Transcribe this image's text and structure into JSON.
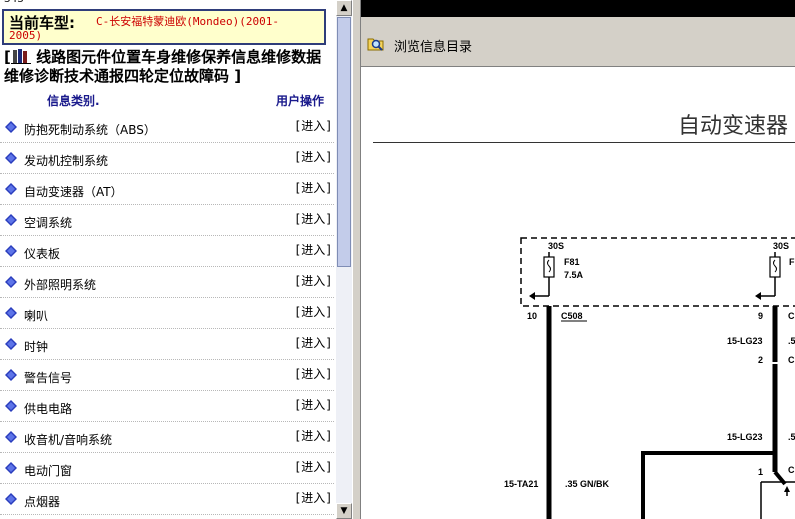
{
  "top_number": "343",
  "car": {
    "label": "当前车型:",
    "value_line1": "C-长安福特蒙迪欧(Mondeo)(2001-",
    "value_line2": "2005)"
  },
  "links_text": "线路图元件位置车身维修保养信息维修数据维修诊断技术通报四轮定位故障码",
  "header": {
    "category": "信息类别.",
    "action": "用户操作"
  },
  "rows": [
    {
      "name": "防抱死制动系统（ABS）",
      "action": "[进入]"
    },
    {
      "name": "发动机控制系统",
      "action": "[进入]"
    },
    {
      "name": "自动变速器（AT）",
      "action": "[进入]"
    },
    {
      "name": "空调系统",
      "action": "[进入]"
    },
    {
      "name": "仪表板",
      "action": "[进入]"
    },
    {
      "name": "外部照明系统",
      "action": "[进入]"
    },
    {
      "name": "喇叭",
      "action": "[进入]"
    },
    {
      "name": "时钟",
      "action": "[进入]"
    },
    {
      "name": "警告信号",
      "action": "[进入]"
    },
    {
      "name": "供电电路",
      "action": "[进入]"
    },
    {
      "name": "收音机/音响系统",
      "action": "[进入]"
    },
    {
      "name": "电动门窗",
      "action": "[进入]"
    },
    {
      "name": "点烟器",
      "action": "[进入]"
    }
  ],
  "right_toolbar": {
    "label": "浏览信息目录",
    "icon": "folder-search-icon"
  },
  "document": {
    "title": "自动变速器",
    "diagram_labels": {
      "a30s": "30S",
      "b30s": "30S",
      "f81": "F81",
      "f81_rating": "7.5A",
      "f_right": "F",
      "pin10": "10",
      "c508": "C508",
      "pin9": "9",
      "c_right1": "C",
      "lg23a": "15-LG23",
      "lg23a_size": ".5",
      "pin2": "2",
      "c_right2": "C",
      "lg23b": "15-LG23",
      "lg23b_size": ".5",
      "pin1": "1",
      "c_right3": "C",
      "ta21": "15-TA21",
      "gnbk": ".35 GN/BK"
    }
  }
}
